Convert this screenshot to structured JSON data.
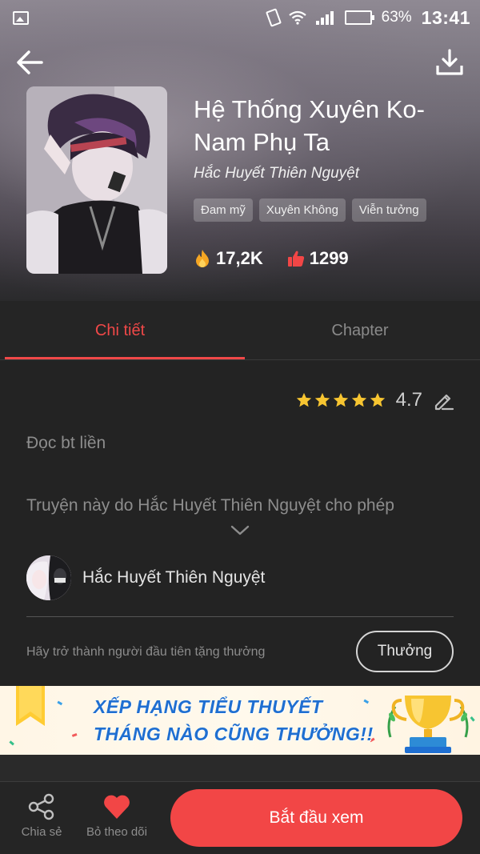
{
  "status_bar": {
    "battery_text": "63%",
    "battery_level": 0.63,
    "time": "13:41"
  },
  "book": {
    "title": "Hệ Thống Xuyên Ko-Nam Phụ Ta",
    "author": "Hắc Huyết Thiên Nguyệt",
    "tags": [
      "Đam mỹ",
      "Xuyên Không",
      "Viễn tưởng"
    ],
    "views": "17,2K",
    "likes": "1299",
    "rating": "4.7",
    "rating_stars": 5
  },
  "tabs": [
    {
      "label": "Chi tiết",
      "active": true
    },
    {
      "label": "Chapter",
      "active": false
    }
  ],
  "detail": {
    "description_line1": "Đọc bt liền",
    "description_line2": "Truyện này do Hắc Huyết Thiên Nguyệt cho phép",
    "uploader_name": "Hắc Huyết Thiên Nguyệt",
    "reward_prompt": "Hãy trở thành người đầu tiên tặng thưởng",
    "reward_button": "Thưởng"
  },
  "banner": {
    "line1": "XẾP HẠNG TIỂU THUYẾT",
    "line2": "THÁNG NÀO CŨNG THƯỞNG!!"
  },
  "bottom_bar": {
    "share_label": "Chia sẻ",
    "follow_label": "Bỏ theo dõi",
    "start_label": "Bắt đầu xem"
  },
  "colors": {
    "accent": "#f04848",
    "background": "#232323",
    "banner_text": "#1f6fd1"
  },
  "icons": [
    "image-icon",
    "vibrate-icon",
    "wifi-icon",
    "signal-icon",
    "battery-icon",
    "back-arrow-icon",
    "download-icon",
    "fire-icon",
    "thumbs-up-icon",
    "star-icon",
    "edit-icon",
    "chevron-down-icon",
    "share-icon",
    "heart-icon",
    "trophy-icon"
  ]
}
